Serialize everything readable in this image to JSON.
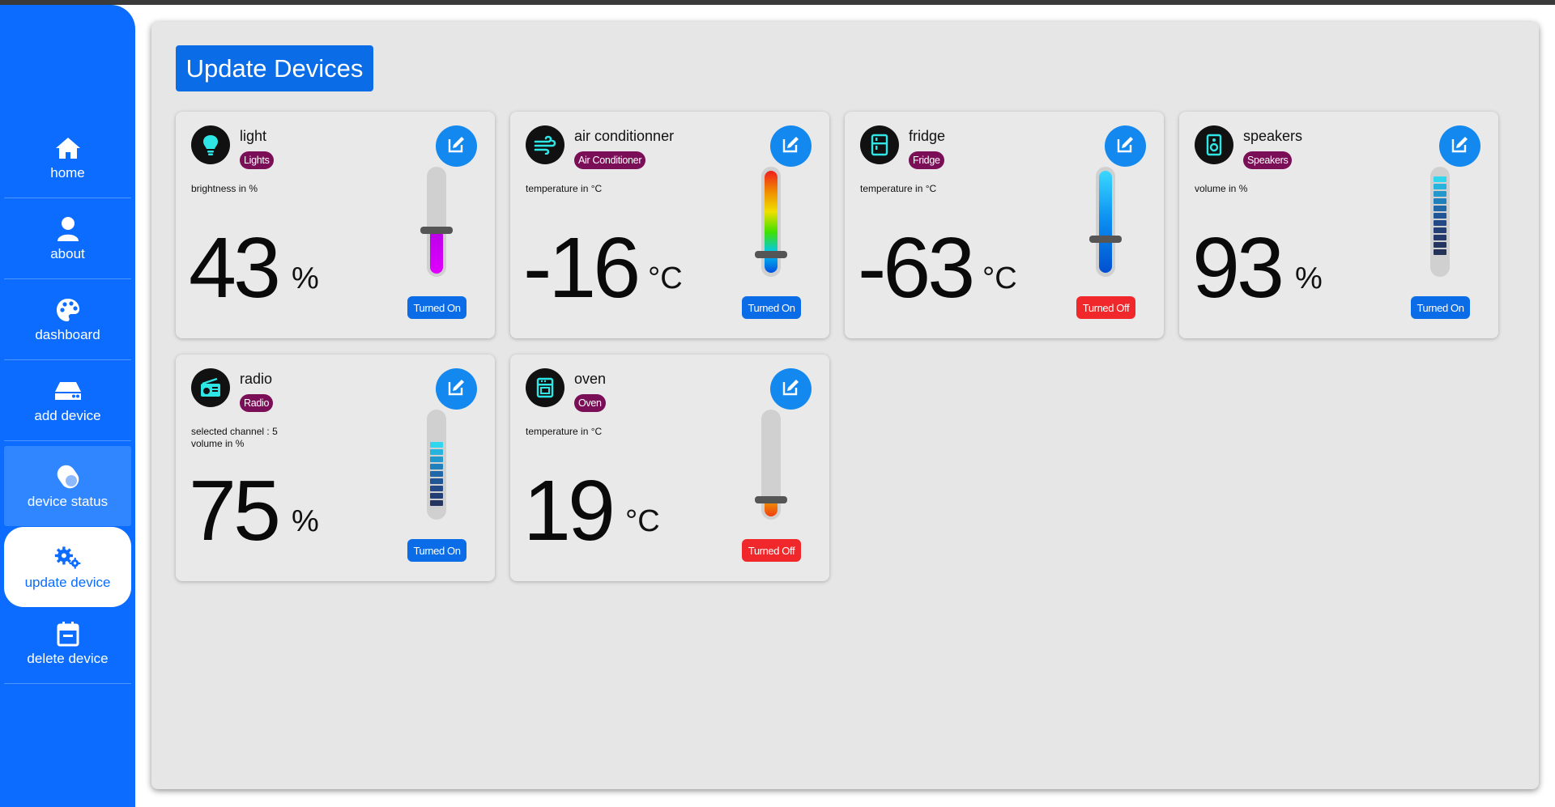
{
  "sidebar": {
    "items": [
      {
        "label": "home",
        "icon": "home-icon"
      },
      {
        "label": "about",
        "icon": "user-icon"
      },
      {
        "label": "dashboard",
        "icon": "palette-icon"
      },
      {
        "label": "add device",
        "icon": "hdd-icon"
      },
      {
        "label": "device status",
        "icon": "toggle-icon"
      },
      {
        "label": "update device",
        "icon": "gears-icon"
      },
      {
        "label": "delete device",
        "icon": "calendar-icon"
      }
    ],
    "active": "update device",
    "color": "#0b6cff"
  },
  "header": {
    "title": "Update Devices"
  },
  "devices": [
    {
      "name": "light",
      "type": "Lights",
      "meta": "brightness in %",
      "value": "43",
      "unit": "%",
      "status": "Turned On",
      "icon": "lightbulb-icon",
      "level": 0.43
    },
    {
      "name": "air conditionner",
      "type": "Air Conditioner",
      "meta": "temperature in °C",
      "value": "-16",
      "unit": "°C",
      "status": "Turned On",
      "icon": "wind-icon",
      "level": 0.16
    },
    {
      "name": "fridge",
      "type": "Fridge",
      "meta": "temperature in °C",
      "value": "-63",
      "unit": "°C",
      "status": "Turned Off",
      "icon": "fridge-icon",
      "level": 0.37
    },
    {
      "name": "speakers",
      "type": "Speakers",
      "meta": "volume in %",
      "value": "93",
      "unit": "%",
      "status": "Turned On",
      "icon": "speaker-icon",
      "level": 0.93
    },
    {
      "name": "radio",
      "type": "Radio",
      "meta": "selected channel : 5",
      "meta2": "volume in %",
      "value": "75",
      "unit": "%",
      "status": "Turned On",
      "icon": "radio-icon",
      "level": 0.75
    },
    {
      "name": "oven",
      "type": "Oven",
      "meta": "temperature in °C",
      "value": "19",
      "unit": "°C",
      "status": "Turned Off",
      "icon": "oven-icon",
      "level": 0.19
    }
  ],
  "colors": {
    "on": "#0b6ce8",
    "off": "#f0282b",
    "badge": "#7a0f57",
    "edit": "#1389f0",
    "icon_cyan": "#2fe6e6"
  }
}
